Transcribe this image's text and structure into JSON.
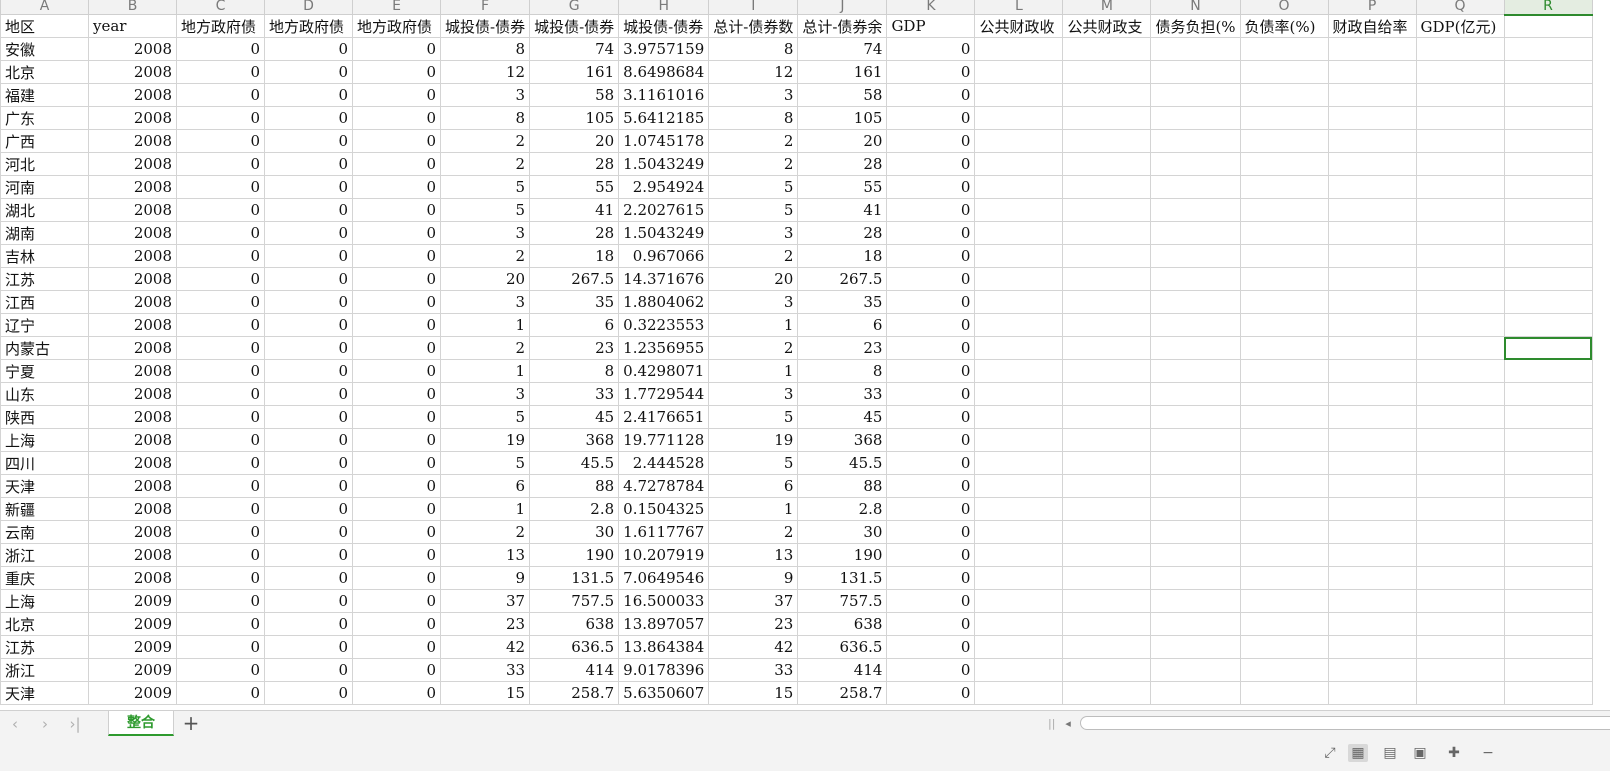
{
  "columns": [
    "A",
    "B",
    "C",
    "D",
    "E",
    "F",
    "G",
    "H",
    "I",
    "J",
    "K",
    "L",
    "M",
    "N",
    "O",
    "P",
    "Q",
    "R"
  ],
  "active_column": "R",
  "headers": [
    "地区",
    "year",
    "地方政府债",
    "地方政府债",
    "地方政府债",
    "城投债-债券",
    "城投债-债券",
    "城投债-债券",
    "总计-债券数",
    "总计-债券余",
    "GDP",
    "公共财政收",
    "公共财政支",
    "债务负担(%",
    "负债率(%)",
    "财政自给率",
    "GDP(亿元)",
    ""
  ],
  "rows": [
    [
      "安徽",
      "2008",
      "0",
      "0",
      "0",
      "8",
      "74",
      "3.9757159",
      "8",
      "74",
      "0"
    ],
    [
      "北京",
      "2008",
      "0",
      "0",
      "0",
      "12",
      "161",
      "8.6498684",
      "12",
      "161",
      "0"
    ],
    [
      "福建",
      "2008",
      "0",
      "0",
      "0",
      "3",
      "58",
      "3.1161016",
      "3",
      "58",
      "0"
    ],
    [
      "广东",
      "2008",
      "0",
      "0",
      "0",
      "8",
      "105",
      "5.6412185",
      "8",
      "105",
      "0"
    ],
    [
      "广西",
      "2008",
      "0",
      "0",
      "0",
      "2",
      "20",
      "1.0745178",
      "2",
      "20",
      "0"
    ],
    [
      "河北",
      "2008",
      "0",
      "0",
      "0",
      "2",
      "28",
      "1.5043249",
      "2",
      "28",
      "0"
    ],
    [
      "河南",
      "2008",
      "0",
      "0",
      "0",
      "5",
      "55",
      "2.954924",
      "5",
      "55",
      "0"
    ],
    [
      "湖北",
      "2008",
      "0",
      "0",
      "0",
      "5",
      "41",
      "2.2027615",
      "5",
      "41",
      "0"
    ],
    [
      "湖南",
      "2008",
      "0",
      "0",
      "0",
      "3",
      "28",
      "1.5043249",
      "3",
      "28",
      "0"
    ],
    [
      "吉林",
      "2008",
      "0",
      "0",
      "0",
      "2",
      "18",
      "0.967066",
      "2",
      "18",
      "0"
    ],
    [
      "江苏",
      "2008",
      "0",
      "0",
      "0",
      "20",
      "267.5",
      "14.371676",
      "20",
      "267.5",
      "0"
    ],
    [
      "江西",
      "2008",
      "0",
      "0",
      "0",
      "3",
      "35",
      "1.8804062",
      "3",
      "35",
      "0"
    ],
    [
      "辽宁",
      "2008",
      "0",
      "0",
      "0",
      "1",
      "6",
      "0.3223553",
      "1",
      "6",
      "0"
    ],
    [
      "内蒙古",
      "2008",
      "0",
      "0",
      "0",
      "2",
      "23",
      "1.2356955",
      "2",
      "23",
      "0"
    ],
    [
      "宁夏",
      "2008",
      "0",
      "0",
      "0",
      "1",
      "8",
      "0.4298071",
      "1",
      "8",
      "0"
    ],
    [
      "山东",
      "2008",
      "0",
      "0",
      "0",
      "3",
      "33",
      "1.7729544",
      "3",
      "33",
      "0"
    ],
    [
      "陕西",
      "2008",
      "0",
      "0",
      "0",
      "5",
      "45",
      "2.4176651",
      "5",
      "45",
      "0"
    ],
    [
      "上海",
      "2008",
      "0",
      "0",
      "0",
      "19",
      "368",
      "19.771128",
      "19",
      "368",
      "0"
    ],
    [
      "四川",
      "2008",
      "0",
      "0",
      "0",
      "5",
      "45.5",
      "2.444528",
      "5",
      "45.5",
      "0"
    ],
    [
      "天津",
      "2008",
      "0",
      "0",
      "0",
      "6",
      "88",
      "4.7278784",
      "6",
      "88",
      "0"
    ],
    [
      "新疆",
      "2008",
      "0",
      "0",
      "0",
      "1",
      "2.8",
      "0.1504325",
      "1",
      "2.8",
      "0"
    ],
    [
      "云南",
      "2008",
      "0",
      "0",
      "0",
      "2",
      "30",
      "1.6117767",
      "2",
      "30",
      "0"
    ],
    [
      "浙江",
      "2008",
      "0",
      "0",
      "0",
      "13",
      "190",
      "10.207919",
      "13",
      "190",
      "0"
    ],
    [
      "重庆",
      "2008",
      "0",
      "0",
      "0",
      "9",
      "131.5",
      "7.0649546",
      "9",
      "131.5",
      "0"
    ],
    [
      "上海",
      "2009",
      "0",
      "0",
      "0",
      "37",
      "757.5",
      "16.500033",
      "37",
      "757.5",
      "0"
    ],
    [
      "北京",
      "2009",
      "0",
      "0",
      "0",
      "23",
      "638",
      "13.897057",
      "23",
      "638",
      "0"
    ],
    [
      "江苏",
      "2009",
      "0",
      "0",
      "0",
      "42",
      "636.5",
      "13.864384",
      "42",
      "636.5",
      "0"
    ],
    [
      "浙江",
      "2009",
      "0",
      "0",
      "0",
      "33",
      "414",
      "9.0178396",
      "33",
      "414",
      "0"
    ],
    [
      "天津",
      "2009",
      "0",
      "0",
      "0",
      "15",
      "258.7",
      "5.6350607",
      "15",
      "258.7",
      "0"
    ]
  ],
  "sheet_tabs": [
    "整合"
  ],
  "icons": {
    "first": "first-sheet-icon",
    "prev": "prev-sheet-icon",
    "next": "next-sheet-icon",
    "last": "last-sheet-icon",
    "add": "add-sheet-icon"
  },
  "accent_color": "#2e9a2e"
}
